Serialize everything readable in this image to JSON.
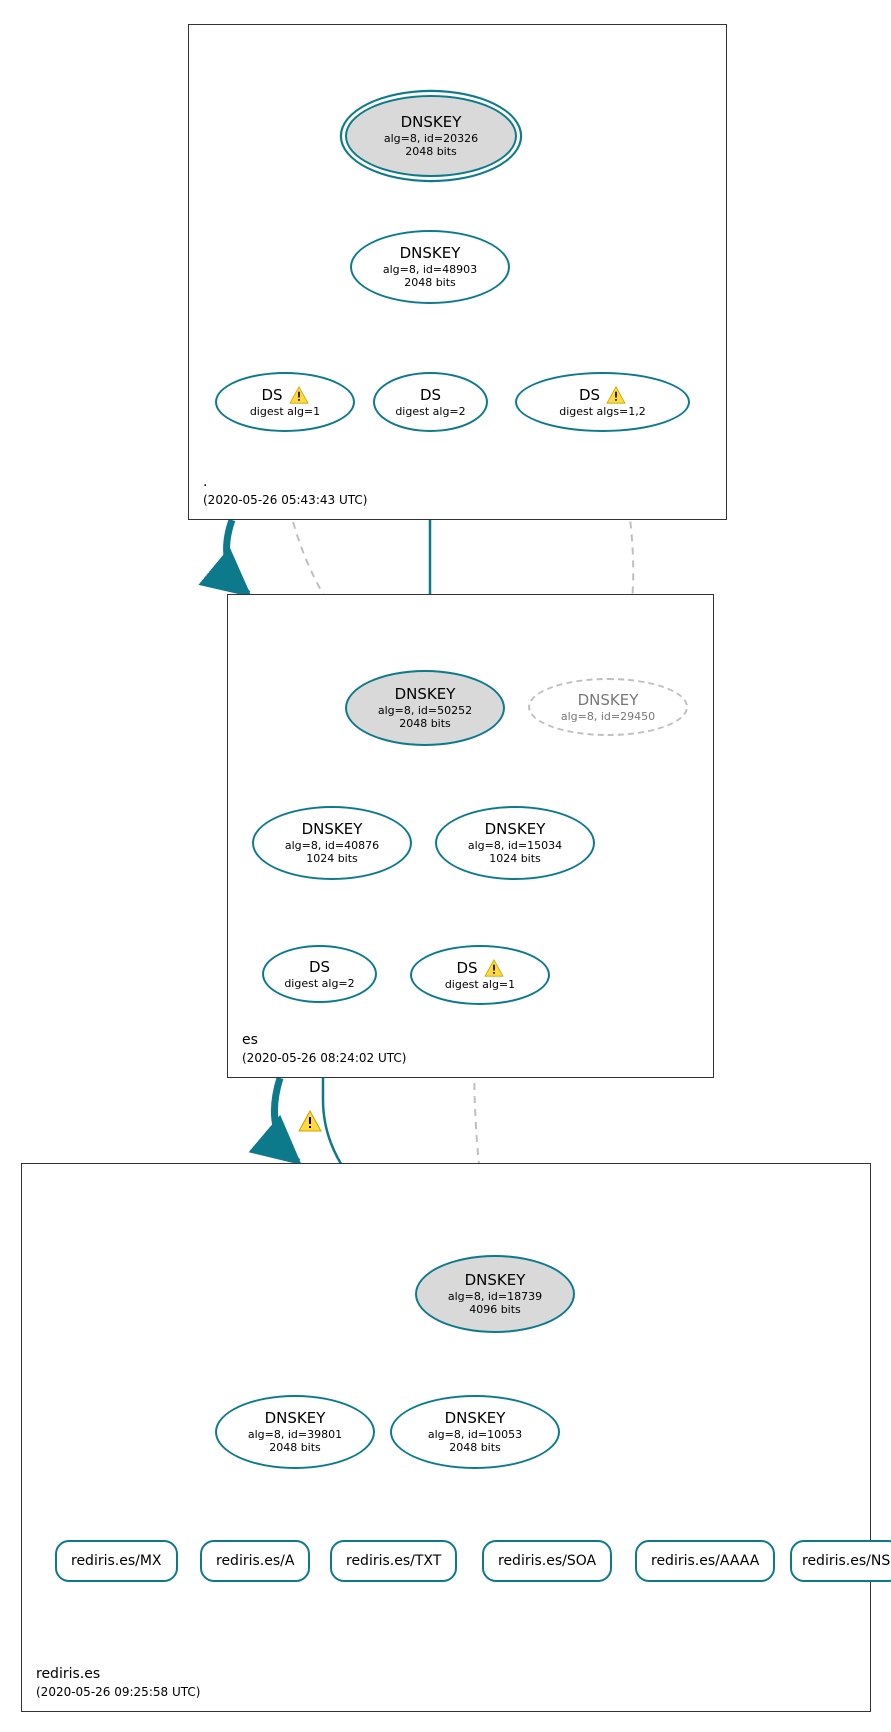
{
  "zones": {
    "root": {
      "name": ".",
      "time": "(2020-05-26 05:43:43 UTC)"
    },
    "es": {
      "name": "es",
      "time": "(2020-05-26 08:24:02 UTC)"
    },
    "rediris": {
      "name": "rediris.es",
      "time": "(2020-05-26 09:25:58 UTC)"
    }
  },
  "nodes": {
    "root_ksk": {
      "title": "DNSKEY",
      "sub1": "alg=8, id=20326",
      "sub2": "2048 bits"
    },
    "root_zsk": {
      "title": "DNSKEY",
      "sub1": "alg=8, id=48903",
      "sub2": "2048 bits"
    },
    "root_ds1": {
      "title": "DS",
      "sub": "digest alg=1"
    },
    "root_ds2": {
      "title": "DS",
      "sub": "digest alg=2"
    },
    "root_ds12": {
      "title": "DS",
      "sub": "digest algs=1,2"
    },
    "es_ksk": {
      "title": "DNSKEY",
      "sub1": "alg=8, id=50252",
      "sub2": "2048 bits"
    },
    "es_ghost": {
      "title": "DNSKEY",
      "sub1": "alg=8, id=29450"
    },
    "es_zsk1": {
      "title": "DNSKEY",
      "sub1": "alg=8, id=40876",
      "sub2": "1024 bits"
    },
    "es_zsk2": {
      "title": "DNSKEY",
      "sub1": "alg=8, id=15034",
      "sub2": "1024 bits"
    },
    "es_ds2": {
      "title": "DS",
      "sub": "digest alg=2"
    },
    "es_ds1": {
      "title": "DS",
      "sub": "digest alg=1"
    },
    "red_ksk": {
      "title": "DNSKEY",
      "sub1": "alg=8, id=18739",
      "sub2": "4096 bits"
    },
    "red_zsk1": {
      "title": "DNSKEY",
      "sub1": "alg=8, id=39801",
      "sub2": "2048 bits"
    },
    "red_zsk2": {
      "title": "DNSKEY",
      "sub1": "alg=8, id=10053",
      "sub2": "2048 bits"
    }
  },
  "rr": {
    "mx": "rediris.es/MX",
    "a": "rediris.es/A",
    "txt": "rediris.es/TXT",
    "soa": "rediris.es/SOA",
    "aaaa": "rediris.es/AAAA",
    "ns": "rediris.es/NS"
  }
}
